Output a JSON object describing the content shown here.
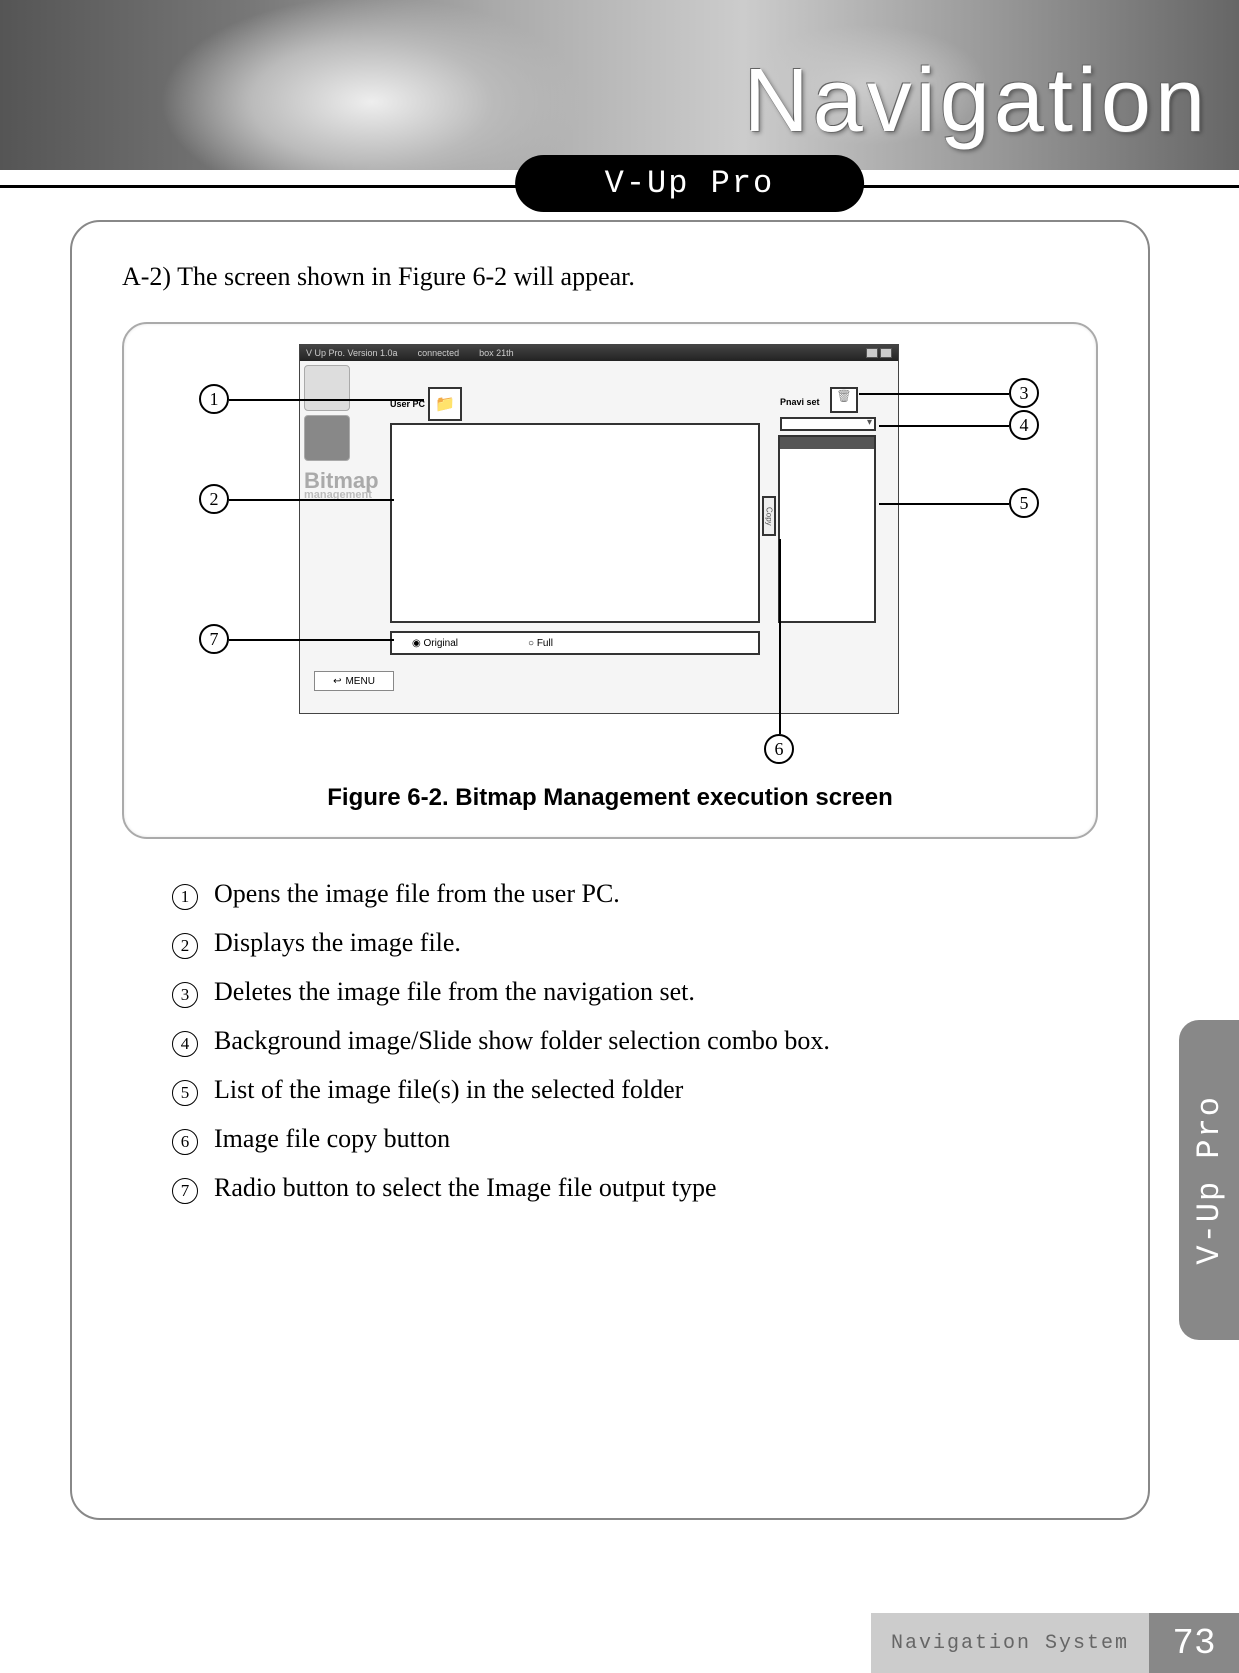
{
  "banner": {
    "title": "Navigation"
  },
  "pill": {
    "label": "V-Up Pro"
  },
  "intro": "A-2) The screen shown in Figure 6-2 will appear.",
  "app": {
    "titlebar": {
      "name": "V Up Pro. Version 1.0a",
      "status": "connected",
      "box": "box 21th"
    },
    "userpc_label": "User PC",
    "pnavi_label": "Pnavi set",
    "bitmap_label": "Bitmap",
    "bitmap_sub": "management",
    "radio1": "Original",
    "radio2": "Full",
    "menu": "MENU",
    "copy": "Copy"
  },
  "callouts": {
    "c1": "1",
    "c2": "2",
    "c3": "3",
    "c4": "4",
    "c5": "5",
    "c6": "6",
    "c7": "7"
  },
  "figure_caption": "Figure 6-2. Bitmap Management execution screen",
  "legend": [
    {
      "n": "1",
      "text": "Opens the image file from the user PC."
    },
    {
      "n": "2",
      "text": "Displays the image file."
    },
    {
      "n": "3",
      "text": "Deletes the image file from the navigation set."
    },
    {
      "n": "4",
      "text": "Background image/Slide show folder selection combo box."
    },
    {
      "n": "5",
      "text": "List of the image file(s) in the selected folder"
    },
    {
      "n": "6",
      "text": "Image file copy button"
    },
    {
      "n": "7",
      "text": "Radio button to select the Image file output type"
    }
  ],
  "side_tab": "V-Up Pro",
  "footer": {
    "label": "Navigation System",
    "page": "73"
  }
}
